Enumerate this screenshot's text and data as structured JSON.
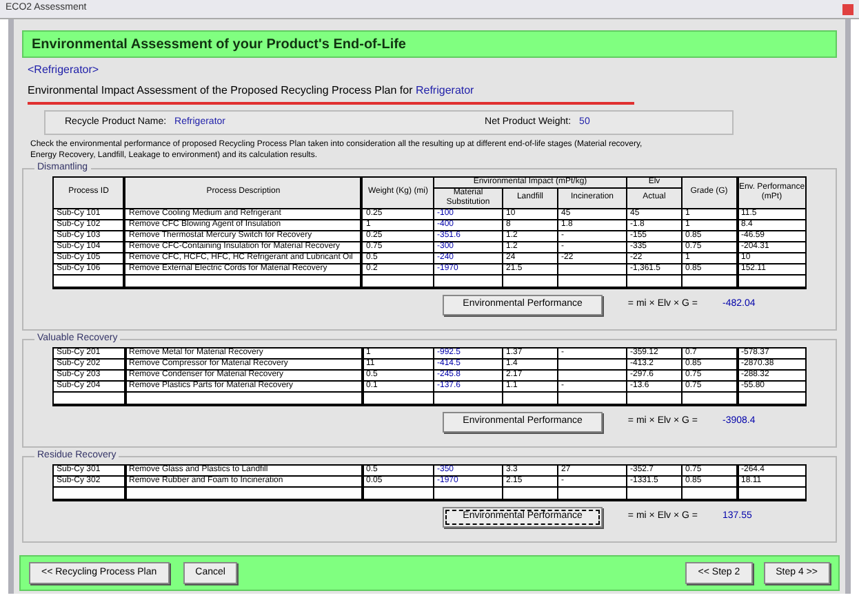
{
  "window": {
    "title": "ECO2 Assessment"
  },
  "header": "Environmental Assessment of your Product's End-of-Life",
  "breadcrumb": "<Refrigerator>",
  "subtitle": {
    "text": "Environmental Impact Assessment of the Proposed Recycling Process Plan for",
    "product": "Refrigerator"
  },
  "product_info": {
    "name_label": "Recycle Product Name:",
    "name": "Refrigerator",
    "weight_label": "Net Product Weight:",
    "weight": "50"
  },
  "description": "Check the environmental performance of proposed Recycling Process Plan taken into consideration all the resulting up at different end-of-life stages (Material recovery, Energy Recovery, Landfill, Leakage to environment) and its calculation results.",
  "columns": {
    "process_id": "Process ID",
    "description": "Process Description",
    "weight": "Weight (Kg) (mi)",
    "impact_group": "Environmental Impact (mPt/kg)",
    "material": "Material Substitution",
    "landfill": "Landfill",
    "incineration": "Incineration",
    "elv_group": "Elv",
    "actual": "Actual",
    "grade": "Grade (G)",
    "performance": "Env. Performance (mPt)"
  },
  "sections": [
    {
      "title": "Dismantling",
      "button": {
        "label": "Environmental Performance",
        "focused": false
      },
      "formula": "= mi × Elv × G =",
      "total": "-482.04",
      "rows": [
        {
          "id": "Sub-Cy 101",
          "description": "Remove Cooling Medium and Refrigerant",
          "weight": "0.25",
          "material": "-100",
          "landfill": "10",
          "incineration": "45",
          "actual": "45",
          "grade": "1",
          "performance": "11.5"
        },
        {
          "id": "Sub-Cy 102",
          "description": "Remove CFC Blowing Agent of Insulation",
          "weight": "1",
          "material": "-400",
          "landfill": "8",
          "incineration": "1.8",
          "actual": "-1.8",
          "grade": "1",
          "performance": "8.4"
        },
        {
          "id": "Sub-Cy 103",
          "description": "Remove Thermostat Mercury Switch for Recovery",
          "weight": "0.25",
          "material": "-351.6",
          "landfill": "1.2",
          "incineration": "-",
          "actual": "-155",
          "grade": "0.85",
          "performance": "-46.59"
        },
        {
          "id": "Sub-Cy 104",
          "description": "Remove CFC-Containing Insulation for Material Recovery",
          "weight": "0.75",
          "material": "-300",
          "landfill": "1.2",
          "incineration": "-",
          "actual": "-335",
          "grade": "0.75",
          "performance": "-204.31"
        },
        {
          "id": "Sub-Cy 105",
          "description": "Remove CFC, HCFC, HFC, HC Refrigerant and Lubricant Oil",
          "weight": "0.5",
          "material": "-240",
          "landfill": "24",
          "incineration": "-22",
          "actual": "-22",
          "grade": "1",
          "performance": "10"
        },
        {
          "id": "Sub-Cy 106",
          "description": "Remove External Electric Cords for Material Recovery",
          "weight": "0.2",
          "material": "-1970",
          "landfill": "21.5",
          "incineration": "",
          "actual": "-1,361.5",
          "grade": "0.85",
          "performance": "152.11"
        }
      ]
    },
    {
      "title": "Valuable Recovery",
      "button": {
        "label": "Environmental Performance",
        "focused": false
      },
      "formula": "= mi × Elv × G =",
      "total": "-3908.4",
      "rows": [
        {
          "id": "Sub-Cy 201",
          "description": "Remove Metal for Material Recovery",
          "weight": "1",
          "material": "-992.5",
          "landfill": "1.37",
          "incineration": "-",
          "actual": "-359.12",
          "grade": "0.7",
          "performance": "-578.37"
        },
        {
          "id": "Sub-Cy 202",
          "description": "Remove Compressor for Material Recovery",
          "weight": "11",
          "material": "-414.5",
          "landfill": "1.4",
          "incineration": "",
          "actual": "-413.2",
          "grade": "0.85",
          "performance": "-2870.38"
        },
        {
          "id": "Sub-Cy 203",
          "description": "Remove Condenser for Material Recovery",
          "weight": "0.5",
          "material": "-245.8",
          "landfill": "2.17",
          "incineration": "",
          "actual": "-297.6",
          "grade": "0.75",
          "performance": "-288.32"
        },
        {
          "id": "Sub-Cy 204",
          "description": "Remove Plastics Parts for Material Recovery",
          "weight": "0.1",
          "material": "-137.6",
          "landfill": "1.1",
          "incineration": "-",
          "actual": "-13.6",
          "grade": "0.75",
          "performance": "-55.80"
        }
      ]
    },
    {
      "title": "Residue Recovery",
      "button": {
        "label": "Environmental Performance",
        "focused": true
      },
      "formula": "= mi × Elv × G =",
      "total": "137.55",
      "rows": [
        {
          "id": "Sub-Cy 301",
          "description": "Remove Glass and Plastics to Landfill",
          "weight": "0.5",
          "material": "-350",
          "landfill": "3.3",
          "incineration": "27",
          "actual": "-352.7",
          "grade": "0.75",
          "performance": "-264.4"
        },
        {
          "id": "Sub-Cy 302",
          "description": "Remove Rubber and Foam to Incineration",
          "weight": "0.05",
          "material": "-1970",
          "landfill": "2.15",
          "incineration": "-",
          "actual": "-1331.5",
          "grade": "0.85",
          "performance": "18.11"
        }
      ]
    }
  ],
  "footer": {
    "left": [
      "<< Recycling Process Plan",
      "Cancel"
    ],
    "right": [
      "<< Step 2",
      "Step 4 >>"
    ]
  }
}
